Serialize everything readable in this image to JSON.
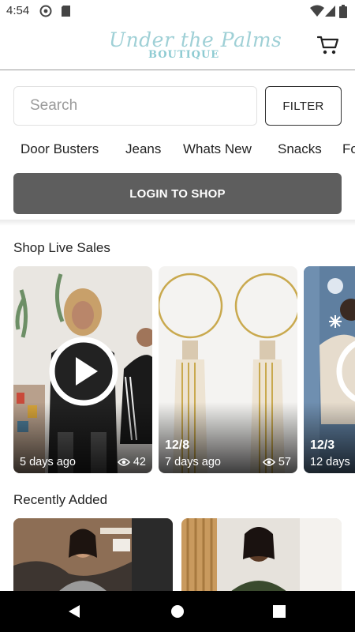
{
  "status_bar": {
    "time": "4:54",
    "icons": [
      "at-sign-icon",
      "sd-card-icon",
      "wifi-icon",
      "signal-icon",
      "battery-icon"
    ]
  },
  "header": {
    "logo_main": "Under the Palms",
    "logo_sub": "BOUTIQUE",
    "cart_icon": "cart-icon",
    "brand_color": "#9fd0d6"
  },
  "search": {
    "placeholder": "Search",
    "filter_label": "FILTER"
  },
  "categories": [
    "Door Busters",
    "Jeans",
    "Whats New",
    "Snacks",
    "Fo"
  ],
  "login": {
    "label": "LOGIN TO SHOP",
    "color": "#5e5e5e"
  },
  "live_sales": {
    "title": "Shop Live Sales",
    "cards": [
      {
        "date": "",
        "ago": "5 days ago",
        "views": "42",
        "has_play": true
      },
      {
        "date": "12/8",
        "ago": "7 days ago",
        "views": "57",
        "has_play": false
      },
      {
        "date": "12/3",
        "ago": "12 days",
        "views": "",
        "has_play": true
      }
    ]
  },
  "recently_added": {
    "title": "Recently Added"
  },
  "nav_bar": {
    "icons": [
      "back-icon",
      "home-icon",
      "recents-icon"
    ]
  }
}
